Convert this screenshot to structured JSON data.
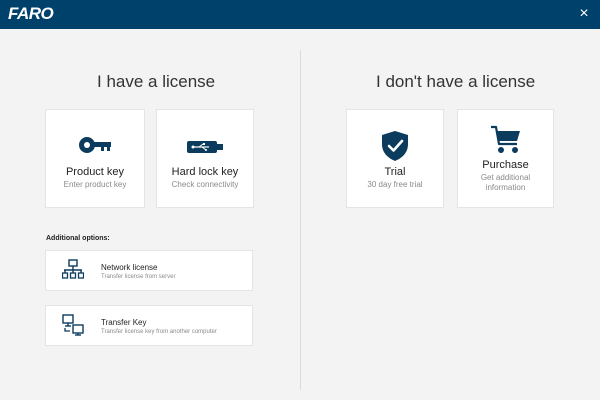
{
  "app": {
    "logo_text": "FARO",
    "close_symbol": "×"
  },
  "left": {
    "title": "I have a license",
    "cards": [
      {
        "label": "Product key",
        "sub": "Enter product key",
        "icon": "key-icon"
      },
      {
        "label": "Hard lock key",
        "sub": "Check connectivity",
        "icon": "usb-dongle-icon"
      }
    ],
    "options_label": "Additional options:",
    "options": [
      {
        "title": "Network license",
        "sub": "Transfer license from server",
        "icon": "network-icon"
      },
      {
        "title": "Transfer Key",
        "sub": "Transfer license key from another computer",
        "icon": "transfer-computers-icon"
      }
    ]
  },
  "right": {
    "title": "I don't have a license",
    "cards": [
      {
        "label": "Trial",
        "sub": "30 day free trial",
        "icon": "shield-check-icon"
      },
      {
        "label": "Purchase",
        "sub": "Get additional information",
        "icon": "shopping-cart-icon"
      }
    ]
  },
  "colors": {
    "brand": "#00416b",
    "icon": "#0b3c5d",
    "background": "#f3f3f3"
  }
}
